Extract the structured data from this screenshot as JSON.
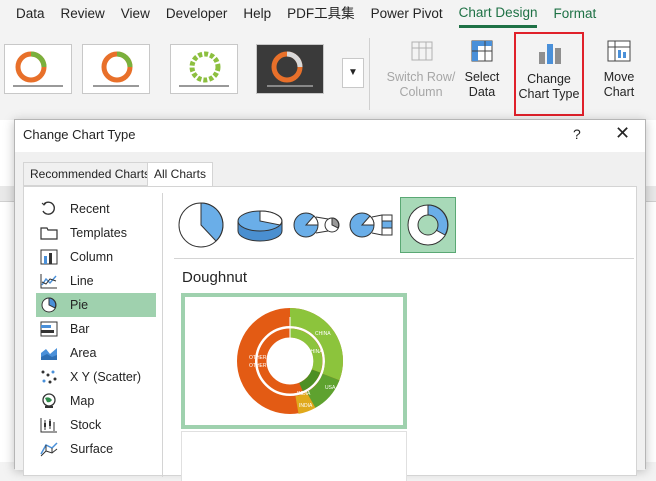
{
  "ribbon_tabs": [
    "Data",
    "Review",
    "View",
    "Developer",
    "Help",
    "PDF工具集",
    "Power Pivot",
    "Chart Design",
    "Format"
  ],
  "ribbon_active_tab": "Chart Design",
  "buttons": {
    "switch_row_col": "Switch Row/\nColumn",
    "select_data": "Select\nData",
    "change_chart_type": "Change\nChart Type",
    "move_chart": "Move\nChart"
  },
  "dialog": {
    "title": "Change Chart Type",
    "help": "?",
    "close": "✕",
    "tabs": [
      "Recommended Charts",
      "All Charts"
    ],
    "active_tab": "All Charts",
    "chart_types": [
      {
        "label": "Recent",
        "icon": "recent-icon"
      },
      {
        "label": "Templates",
        "icon": "folder-icon"
      },
      {
        "label": "Column",
        "icon": "column-chart-icon"
      },
      {
        "label": "Line",
        "icon": "line-chart-icon"
      },
      {
        "label": "Pie",
        "icon": "pie-chart-icon"
      },
      {
        "label": "Bar",
        "icon": "bar-chart-icon"
      },
      {
        "label": "Area",
        "icon": "area-chart-icon"
      },
      {
        "label": "X Y (Scatter)",
        "icon": "scatter-chart-icon"
      },
      {
        "label": "Map",
        "icon": "map-chart-icon"
      },
      {
        "label": "Stock",
        "icon": "stock-chart-icon"
      },
      {
        "label": "Surface",
        "icon": "surface-chart-icon"
      }
    ],
    "selected_type": "Pie",
    "subtypes": [
      "Pie",
      "3-D Pie",
      "Pie of Pie",
      "Bar of Pie",
      "Doughnut"
    ],
    "selected_subtype_name": "Doughnut",
    "preview_labels": [
      "CHINA",
      "CHINA",
      "USA",
      "INDIA",
      "OTHER",
      "OTHER",
      "INDIA"
    ]
  },
  "colors": {
    "accent": "#1e7145",
    "selection": "#9fd1ae",
    "highlight_border": "#e0202a"
  }
}
